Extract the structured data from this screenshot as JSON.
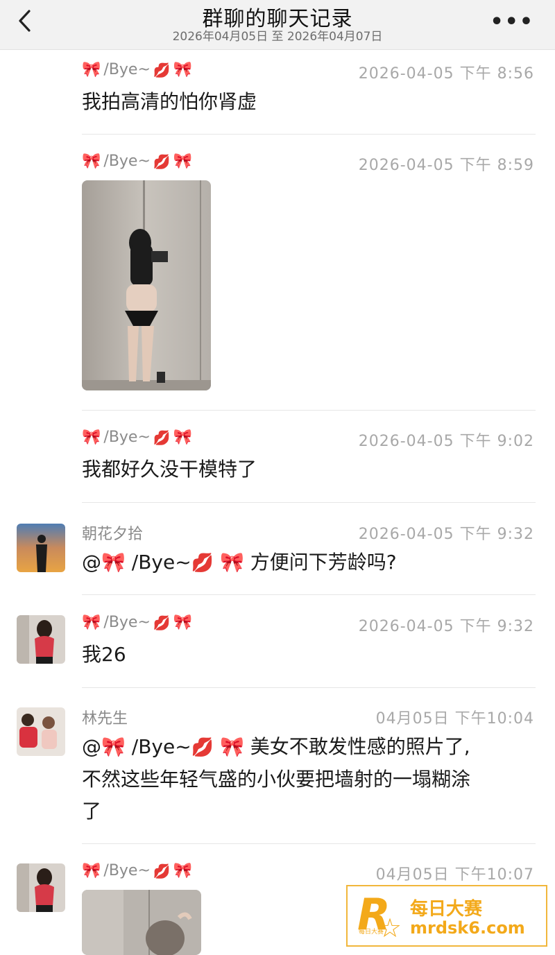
{
  "header": {
    "title": "群聊的聊天记录",
    "subtitle": "2026年04月05日 至 2026年04月07日",
    "more": "•••"
  },
  "icons": {
    "bow": "🎀",
    "lips": "💋"
  },
  "messages": [
    {
      "sender": "/Bye~",
      "time": "2026-04-05 下午 8:56",
      "text": "我拍高清的怕你肾虚"
    },
    {
      "sender": "/Bye~",
      "time": "2026-04-05 下午 8:59",
      "text": ""
    },
    {
      "sender": "/Bye~",
      "time": "2026-04-05 下午 9:02",
      "text": "我都好久没干模特了"
    },
    {
      "sender": "朝花夕拾",
      "time": "2026-04-05 下午 9:32",
      "mention": "@",
      "mention_name": "/Bye~",
      "text": "方便问下芳龄吗?"
    },
    {
      "sender": "/Bye~",
      "time": "2026-04-05 下午 9:32",
      "text": "我26"
    },
    {
      "sender": "林先生",
      "time": "04月05日 下午10:04",
      "mention": "@",
      "mention_name": "/Bye~",
      "text": "美女不敢发性感的照片了,",
      "text2": "不然这些年轻气盛的小伙要把墙射的一塌糊涂",
      "text3": "了"
    },
    {
      "sender": "/Bye~",
      "time": "04月05日 下午10:07",
      "text": ""
    }
  ],
  "watermark": {
    "logo": "R",
    "logo_small": "每日大赛",
    "cn": "每日大赛",
    "url": "mrdsk6.com"
  }
}
